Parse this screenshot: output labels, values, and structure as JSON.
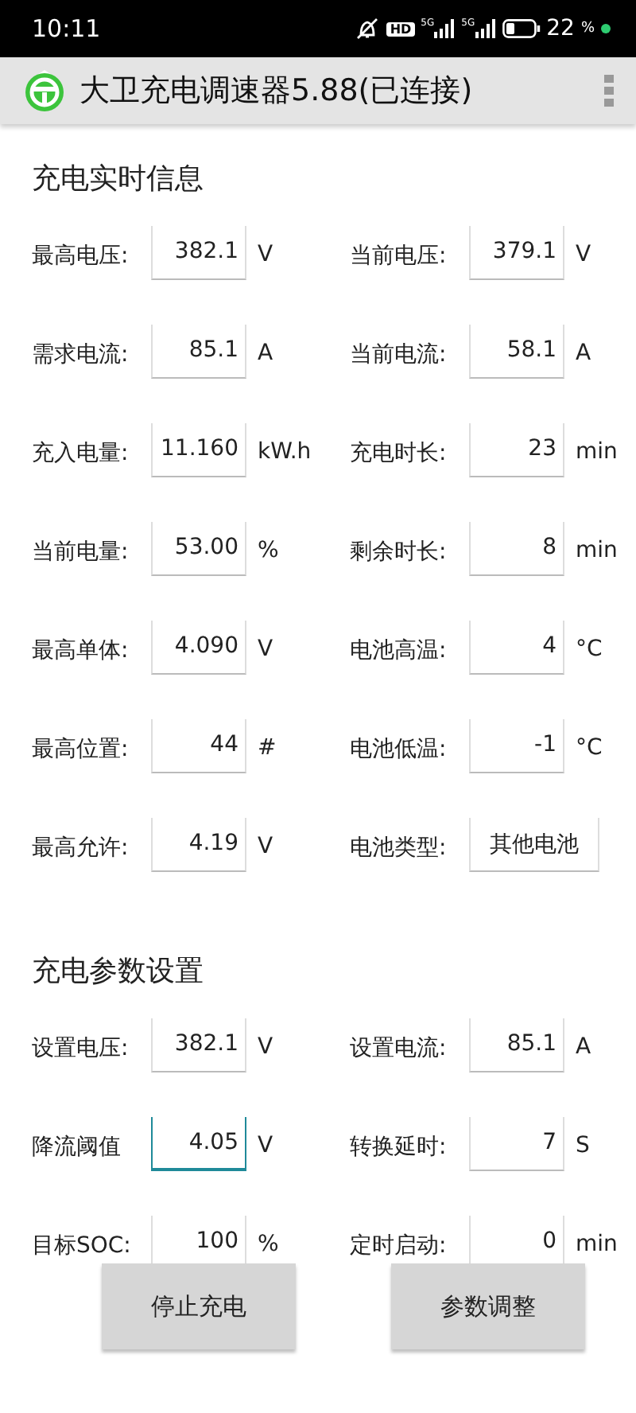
{
  "status_bar": {
    "time": "10:11",
    "hd_label": "HD",
    "network_labels": [
      "5G",
      "5G"
    ],
    "battery_percent": "22",
    "percent_sign": "%"
  },
  "app_bar": {
    "title": "大卫充电调速器5.88(已连接)"
  },
  "sections": [
    {
      "title": "充电实时信息",
      "rows": [
        [
          {
            "label": "最高电压:",
            "value": "382.1",
            "unit": "V",
            "focused": false
          },
          {
            "label": "当前电压:",
            "value": "379.1",
            "unit": "V",
            "focused": false
          }
        ],
        [
          {
            "label": "需求电流:",
            "value": "85.1",
            "unit": "A",
            "focused": false
          },
          {
            "label": "当前电流:",
            "value": "58.1",
            "unit": "A",
            "focused": false
          }
        ],
        [
          {
            "label": "充入电量:",
            "value": "11.160",
            "unit": "kW.h",
            "focused": false
          },
          {
            "label": "充电时长:",
            "value": "23",
            "unit": "min",
            "focused": false
          }
        ],
        [
          {
            "label": "当前电量:",
            "value": "53.00",
            "unit": "%",
            "focused": false
          },
          {
            "label": "剩余时长:",
            "value": "8",
            "unit": "min",
            "focused": false
          }
        ],
        [
          {
            "label": "最高单体:",
            "value": "4.090",
            "unit": "V",
            "focused": false
          },
          {
            "label": "电池高温:",
            "value": "4",
            "unit": "°C",
            "focused": false
          }
        ],
        [
          {
            "label": "最高位置:",
            "value": "44",
            "unit": "#",
            "focused": false
          },
          {
            "label": "电池低温:",
            "value": "-1",
            "unit": "°C",
            "focused": false
          }
        ],
        [
          {
            "label": "最高允许:",
            "value": "4.19",
            "unit": "V",
            "focused": false
          },
          {
            "label": "电池类型:",
            "value": "其他电池",
            "focused": false
          }
        ]
      ]
    },
    {
      "title": "充电参数设置",
      "rows": [
        [
          {
            "label": "设置电压:",
            "value": "382.1",
            "unit": "V",
            "focused": false
          },
          {
            "label": "设置电流:",
            "value": "85.1",
            "unit": "A",
            "focused": false
          }
        ],
        [
          {
            "label": "降流阈值",
            "value": "4.05",
            "unit": "V",
            "focused": true
          },
          {
            "label": "转换延时:",
            "value": "7",
            "unit": "S",
            "focused": false
          }
        ],
        [
          {
            "label": "目标SOC:",
            "value": "100",
            "unit": "%",
            "focused": false
          },
          {
            "label": "定时启动:",
            "value": "0",
            "unit": "min",
            "focused": false
          }
        ]
      ]
    }
  ],
  "buttons": [
    "停止充电",
    "参数调整"
  ]
}
